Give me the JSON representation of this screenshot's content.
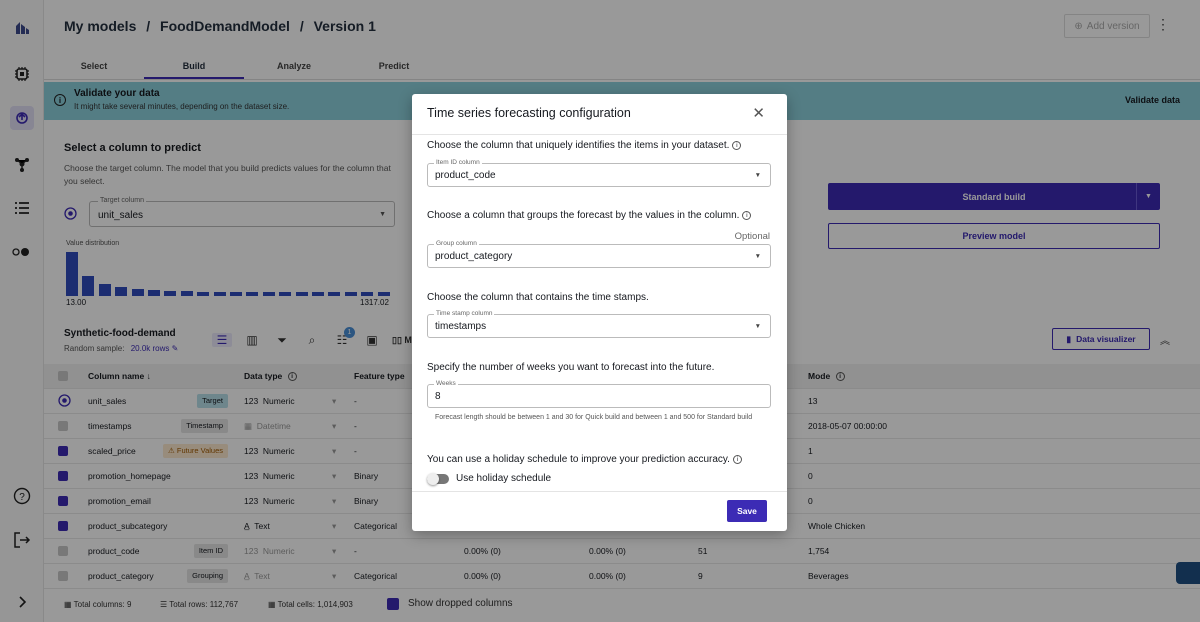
{
  "breadcrumb": [
    "My models",
    "/",
    "FoodDemandModel",
    "/",
    "Version 1"
  ],
  "header": {
    "add_version": "Add version"
  },
  "tabs": [
    "Select",
    "Build",
    "Analyze",
    "Predict"
  ],
  "banner": {
    "title": "Validate your data",
    "subtitle": "It might take several minutes, depending on the dataset size.",
    "action": "Validate data"
  },
  "select": {
    "title": "Select a column to predict",
    "description": "Choose the target column. The model that you build predicts values for the column that you select.",
    "target_label": "Target column",
    "target_value": "unit_sales",
    "value_distribution_label": "Value distribution",
    "histogram": [
      1.0,
      0.45,
      0.28,
      0.2,
      0.16,
      0.13,
      0.12,
      0.11,
      0.1,
      0.1,
      0.1,
      0.1,
      0.1,
      0.1,
      0.1,
      0.1,
      0.1,
      0.1,
      0.1,
      0.1
    ],
    "min": "13.00",
    "max": "1317.02"
  },
  "build": {
    "standard_build": "Standard build",
    "preview_model": "Preview model"
  },
  "dataset": {
    "name": "Synthetic-food-demand",
    "sample_label": "Random sample:",
    "sample_value": "20.0k rows",
    "manage_label": "Mana",
    "notification_count": "1",
    "data_visualizer": "Data visualizer"
  },
  "table": {
    "headers": {
      "column_name": "Column name",
      "data_type": "Data type",
      "feature_type": "Feature type",
      "mode": "Mode"
    },
    "rows": [
      {
        "name": "unit_sales",
        "tag": "Target",
        "dtype_prefix": "123",
        "dtype": "Numeric",
        "feature": "-",
        "c1": "",
        "c2": "",
        "c3": "",
        "mode": "13"
      },
      {
        "name": "timestamps",
        "tag": "Timestamp",
        "dtype_prefix": "▦",
        "dtype": "Datetime",
        "feature": "-",
        "c1": "",
        "c2": "",
        "c3": "",
        "mode": "2018-05-07 00:00:00"
      },
      {
        "name": "scaled_price",
        "tag": "Future Values",
        "dtype_prefix": "123",
        "dtype": "Numeric",
        "feature": "-",
        "c1": "",
        "c2": "",
        "c3": "",
        "mode": "1"
      },
      {
        "name": "promotion_homepage",
        "tag": "",
        "dtype_prefix": "123",
        "dtype": "Numeric",
        "feature": "Binary",
        "c1": "",
        "c2": "",
        "c3": "",
        "mode": "0"
      },
      {
        "name": "promotion_email",
        "tag": "",
        "dtype_prefix": "123",
        "dtype": "Numeric",
        "feature": "Binary",
        "c1": "",
        "c2": "",
        "c3": "",
        "mode": "0"
      },
      {
        "name": "product_subcategory",
        "tag": "",
        "dtype_prefix": "A̲",
        "dtype": "Text",
        "feature": "Categorical",
        "c1": "",
        "c2": "",
        "c3": "",
        "mode": "Whole Chicken"
      },
      {
        "name": "product_code",
        "tag": "Item ID",
        "dtype_prefix": "123",
        "dtype": "Numeric",
        "feature": "-",
        "c1": "0.00% (0)",
        "c2": "0.00% (0)",
        "c3": "51",
        "mode": "1,754"
      },
      {
        "name": "product_category",
        "tag": "Grouping",
        "dtype_prefix": "A̲",
        "dtype": "Text",
        "feature": "Categorical",
        "c1": "0.00% (0)",
        "c2": "0.00% (0)",
        "c3": "9",
        "mode": "Beverages"
      }
    ]
  },
  "footer": {
    "total_columns": "Total columns: 9",
    "total_rows": "Total rows: 112,767",
    "total_cells": "Total cells: 1,014,903",
    "show_dropped": "Show dropped columns"
  },
  "modal": {
    "title": "Time series forecasting configuration",
    "q_item": "Choose the column that uniquely identifies the items in your dataset.",
    "item_label": "Item ID column",
    "item_value": "product_code",
    "q_group": "Choose a column that groups the forecast by the values in the column.",
    "optional": "Optional",
    "group_label": "Group column",
    "group_value": "product_category",
    "q_time": "Choose the column that contains the time stamps.",
    "time_label": "Time stamp column",
    "time_value": "timestamps",
    "q_weeks": "Specify the number of weeks you want to forecast into the future.",
    "weeks_label": "Weeks",
    "weeks_value": "8",
    "weeks_help": "Forecast length should be between 1 and 30 for Quick build and between 1 and 500 for Standard build",
    "q_holiday": "You can use a holiday schedule to improve your prediction accuracy.",
    "holiday_toggle": "Use holiday schedule",
    "save": "Save"
  },
  "colors": {
    "accent": "#3c2bb5",
    "banner": "#8cd0dd",
    "histogram": "#2f4bbd"
  }
}
